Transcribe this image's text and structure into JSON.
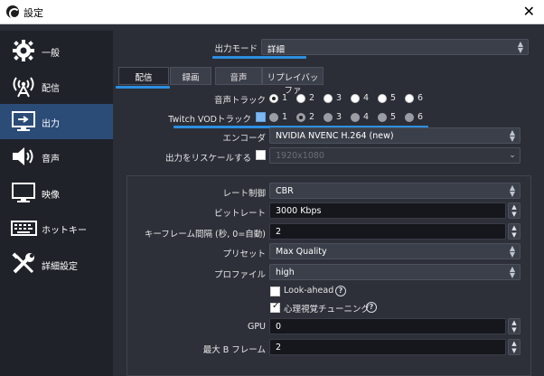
{
  "window": {
    "title": "設定",
    "close_glyph": "✕"
  },
  "sidebar": {
    "items": [
      {
        "label": "一般",
        "icon": "gear-icon"
      },
      {
        "label": "配信",
        "icon": "broadcast-icon"
      },
      {
        "label": "出力",
        "icon": "output-monitor-icon",
        "active": true
      },
      {
        "label": "音声",
        "icon": "speaker-icon"
      },
      {
        "label": "映像",
        "icon": "monitor-icon"
      },
      {
        "label": "ホットキー",
        "icon": "keyboard-icon"
      },
      {
        "label": "詳細設定",
        "icon": "tools-icon"
      }
    ]
  },
  "output_mode": {
    "label": "出力モード",
    "value": "詳細"
  },
  "tabs": [
    {
      "label": "配信",
      "active": true
    },
    {
      "label": "録画"
    },
    {
      "label": "音声"
    },
    {
      "label": "リプレイバッファ"
    }
  ],
  "audio_track": {
    "label": "音声トラック",
    "options": [
      "1",
      "2",
      "3",
      "4",
      "5",
      "6"
    ],
    "selected": "1"
  },
  "twitch_vod": {
    "label": "Twitch VODトラック",
    "options": [
      "1",
      "2",
      "3",
      "4",
      "5",
      "6"
    ],
    "selected": "2"
  },
  "encoder": {
    "label": "エンコーダ",
    "value": "NVIDIA NVENC H.264 (new)"
  },
  "rescale": {
    "label": "出力をリスケールする",
    "value": "1920x1080"
  },
  "settings": {
    "rate_control": {
      "label": "レート制御",
      "value": "CBR"
    },
    "bitrate": {
      "label": "ビットレート",
      "value": "3000 Kbps"
    },
    "keyframe": {
      "label": "キーフレーム間隔 (秒, 0=自動)",
      "value": "2"
    },
    "preset": {
      "label": "プリセット",
      "value": "Max Quality"
    },
    "profile": {
      "label": "プロファイル",
      "value": "high"
    },
    "lookahead": {
      "label": "Look-ahead",
      "checked": false
    },
    "psycho": {
      "label": "心理視覚チューニング",
      "checked": true
    },
    "gpu": {
      "label": "GPU",
      "value": "0"
    },
    "bframes": {
      "label": "最大 B フレーム",
      "value": "2"
    }
  },
  "help_glyph": "?",
  "colors": {
    "accent_blue": "#2d8fe0",
    "active_sidebar": "#2c4c78",
    "background": "#2b2e37"
  }
}
